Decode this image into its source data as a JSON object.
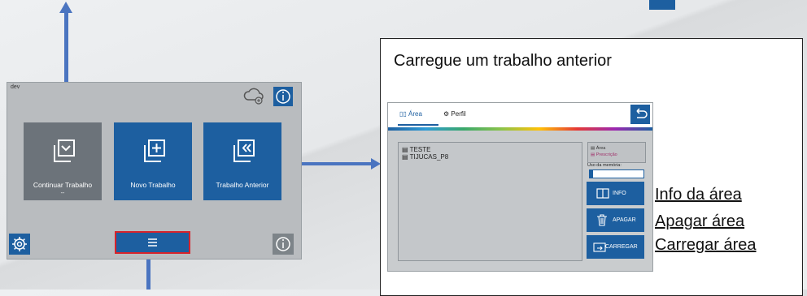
{
  "device": {
    "dev_label": "dev",
    "tiles": [
      {
        "label": "Continuar Trabalho",
        "sublabel": "--"
      },
      {
        "label": "Novo Trabalho"
      },
      {
        "label": "Trabalho Anterior"
      }
    ],
    "menu_icon": "hamburger-icon"
  },
  "callout": {
    "title": "Carregue um trabalho anterior",
    "tabs": [
      {
        "label": "Área",
        "icon": "area-icon"
      },
      {
        "label": "Perfil",
        "icon": "profile-icon"
      }
    ],
    "files": [
      "TESTE",
      "TIJUCAS_P8"
    ],
    "legend": [
      "Área",
      "Prescrição"
    ],
    "memory_label": "Uso da memória:",
    "memory_fraction": 0.06,
    "buttons": [
      {
        "label": "INFO",
        "icon": "info-panel-icon"
      },
      {
        "label": "APAGAR",
        "icon": "trash-icon"
      },
      {
        "label": "CARREGAR",
        "icon": "load-icon"
      }
    ],
    "links": [
      "Info da área",
      "Apagar área",
      "Carregar área"
    ]
  },
  "colors": {
    "accent": "#1d5fa0",
    "arrow": "#4a74c0",
    "highlight": "#d8232a"
  }
}
